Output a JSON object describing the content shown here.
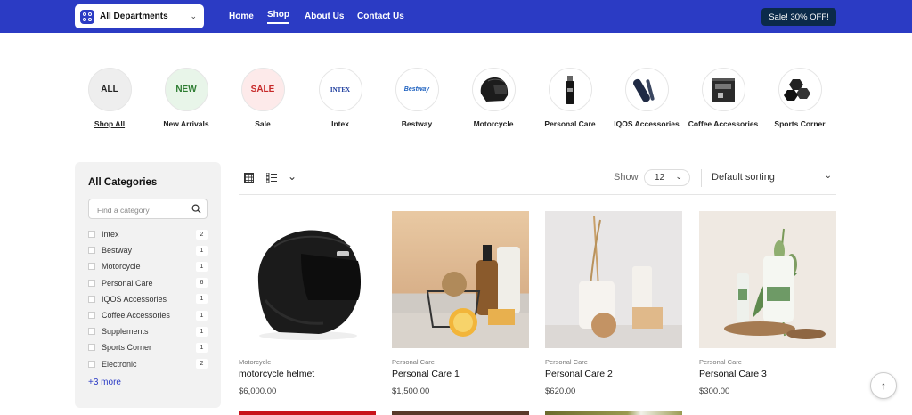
{
  "header": {
    "departments_label": "All Departments",
    "nav": [
      {
        "label": "Home",
        "active": false
      },
      {
        "label": "Shop",
        "active": true
      },
      {
        "label": "About Us",
        "active": false
      },
      {
        "label": "Contact Us",
        "active": false
      }
    ],
    "sale_button": "Sale! 30% OFF!",
    "brand_color": "#2b3bc4"
  },
  "categories_row": [
    {
      "label": "Shop All",
      "circle_text": "ALL",
      "circle_color": "#222",
      "bg": "#eeeeee"
    },
    {
      "label": "New Arrivals",
      "circle_text": "NEW",
      "circle_color": "#2e7d32",
      "bg": "#e8f5e9"
    },
    {
      "label": "Sale",
      "circle_text": "SALE",
      "circle_color": "#c62828",
      "bg": "#fdeaea"
    },
    {
      "label": "Intex",
      "circle_text": "INTEX",
      "circle_color": "#1a3a9c",
      "bg": "#ffffff"
    },
    {
      "label": "Bestway",
      "circle_text": "Bestway",
      "circle_color": "#1a5fbf",
      "bg": "#ffffff"
    },
    {
      "label": "Motorcycle",
      "circle_text": "",
      "bg": "#ffffff"
    },
    {
      "label": "Personal Care",
      "circle_text": "",
      "bg": "#ffffff"
    },
    {
      "label": "IQOS Accessories",
      "circle_text": "",
      "bg": "#ffffff"
    },
    {
      "label": "Coffee Accessories",
      "circle_text": "",
      "bg": "#ffffff"
    },
    {
      "label": "Sports Corner",
      "circle_text": "",
      "bg": "#ffffff"
    }
  ],
  "sidebar": {
    "title": "All Categories",
    "search_placeholder": "Find a category",
    "items": [
      {
        "label": "Intex",
        "count": "2"
      },
      {
        "label": "Bestway",
        "count": "1"
      },
      {
        "label": "Motorcycle",
        "count": "1"
      },
      {
        "label": "Personal Care",
        "count": "6"
      },
      {
        "label": "IQOS Accessories",
        "count": "1"
      },
      {
        "label": "Coffee Accessories",
        "count": "1"
      },
      {
        "label": "Supplements",
        "count": "1"
      },
      {
        "label": "Sports Corner",
        "count": "1"
      },
      {
        "label": "Electronic",
        "count": "2"
      }
    ],
    "more_link": "+3 more"
  },
  "toolbar": {
    "show_label": "Show",
    "per_page": "12",
    "sorting": "Default sorting"
  },
  "products": [
    {
      "category": "Motorcycle",
      "name": "motorcycle helmet",
      "price": "$6,000.00"
    },
    {
      "category": "Personal Care",
      "name": "Personal Care 1",
      "price": "$1,500.00"
    },
    {
      "category": "Personal Care",
      "name": "Personal Care 2",
      "price": "$620.00"
    },
    {
      "category": "Personal Care",
      "name": "Personal Care 3",
      "price": "$300.00"
    }
  ]
}
